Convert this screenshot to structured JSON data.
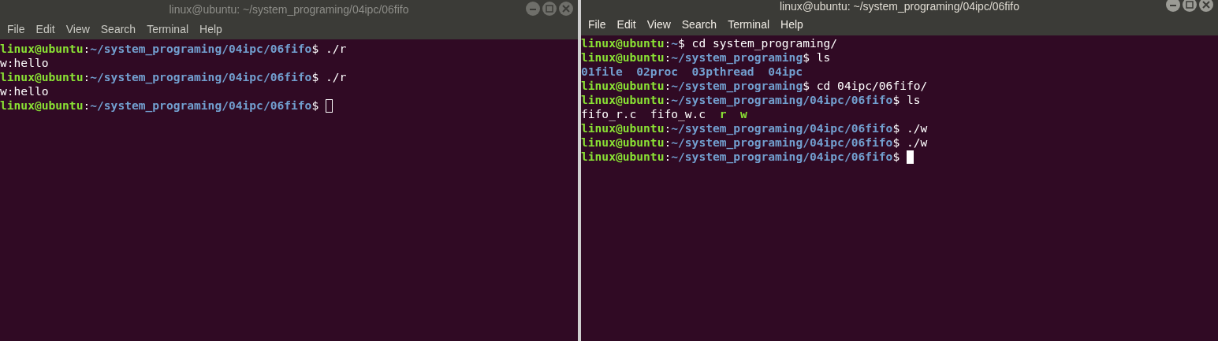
{
  "windows": [
    {
      "title": "linux@ubuntu: ~/system_programing/04ipc/06fifo",
      "focused": false,
      "menu": [
        "File",
        "Edit",
        "View",
        "Search",
        "Terminal",
        "Help"
      ],
      "lines": [
        [
          {
            "kind": "user",
            "text": "linux@ubuntu"
          },
          {
            "kind": "plain",
            "text": ":"
          },
          {
            "kind": "path",
            "text": "~/system_programing/04ipc/06fifo"
          },
          {
            "kind": "plain",
            "text": "$ ./r"
          }
        ],
        [
          {
            "kind": "plain",
            "text": "w:hello"
          }
        ],
        [
          {
            "kind": "user",
            "text": "linux@ubuntu"
          },
          {
            "kind": "plain",
            "text": ":"
          },
          {
            "kind": "path",
            "text": "~/system_programing/04ipc/06fifo"
          },
          {
            "kind": "plain",
            "text": "$ ./r"
          }
        ],
        [
          {
            "kind": "plain",
            "text": "w:hello"
          }
        ],
        [
          {
            "kind": "user",
            "text": "linux@ubuntu"
          },
          {
            "kind": "plain",
            "text": ":"
          },
          {
            "kind": "path",
            "text": "~/system_programing/04ipc/06fifo"
          },
          {
            "kind": "plain",
            "text": "$ "
          },
          {
            "kind": "cursor"
          }
        ]
      ]
    },
    {
      "title": "linux@ubuntu: ~/system_programing/04ipc/06fifo",
      "focused": true,
      "menu": [
        "File",
        "Edit",
        "View",
        "Search",
        "Terminal",
        "Help"
      ],
      "lines": [
        [
          {
            "kind": "user",
            "text": "linux@ubuntu"
          },
          {
            "kind": "plain",
            "text": ":"
          },
          {
            "kind": "path",
            "text": "~"
          },
          {
            "kind": "plain",
            "text": "$ cd system_programing/"
          }
        ],
        [
          {
            "kind": "user",
            "text": "linux@ubuntu"
          },
          {
            "kind": "plain",
            "text": ":"
          },
          {
            "kind": "path",
            "text": "~/system_programing"
          },
          {
            "kind": "plain",
            "text": "$ ls"
          }
        ],
        [
          {
            "kind": "dir",
            "text": "01file"
          },
          {
            "kind": "gap"
          },
          {
            "kind": "dir",
            "text": "02proc"
          },
          {
            "kind": "gap"
          },
          {
            "kind": "dir",
            "text": "03pthread"
          },
          {
            "kind": "gap"
          },
          {
            "kind": "dir",
            "text": "04ipc"
          }
        ],
        [
          {
            "kind": "user",
            "text": "linux@ubuntu"
          },
          {
            "kind": "plain",
            "text": ":"
          },
          {
            "kind": "path",
            "text": "~/system_programing"
          },
          {
            "kind": "plain",
            "text": "$ cd 04ipc/06fifo/"
          }
        ],
        [
          {
            "kind": "user",
            "text": "linux@ubuntu"
          },
          {
            "kind": "plain",
            "text": ":"
          },
          {
            "kind": "path",
            "text": "~/system_programing/04ipc/06fifo"
          },
          {
            "kind": "plain",
            "text": "$ ls"
          }
        ],
        [
          {
            "kind": "plain",
            "text": "fifo_r.c"
          },
          {
            "kind": "gap"
          },
          {
            "kind": "plain",
            "text": "fifo_w.c"
          },
          {
            "kind": "gap"
          },
          {
            "kind": "exec",
            "text": "r"
          },
          {
            "kind": "gap"
          },
          {
            "kind": "exec",
            "text": "w"
          }
        ],
        [
          {
            "kind": "user",
            "text": "linux@ubuntu"
          },
          {
            "kind": "plain",
            "text": ":"
          },
          {
            "kind": "path",
            "text": "~/system_programing/04ipc/06fifo"
          },
          {
            "kind": "plain",
            "text": "$ ./w"
          }
        ],
        [
          {
            "kind": "user",
            "text": "linux@ubuntu"
          },
          {
            "kind": "plain",
            "text": ":"
          },
          {
            "kind": "path",
            "text": "~/system_programing/04ipc/06fifo"
          },
          {
            "kind": "plain",
            "text": "$ ./w"
          }
        ],
        [
          {
            "kind": "user",
            "text": "linux@ubuntu"
          },
          {
            "kind": "plain",
            "text": ":"
          },
          {
            "kind": "path",
            "text": "~/system_programing/04ipc/06fifo"
          },
          {
            "kind": "plain",
            "text": "$ "
          },
          {
            "kind": "cursor"
          }
        ]
      ]
    }
  ]
}
